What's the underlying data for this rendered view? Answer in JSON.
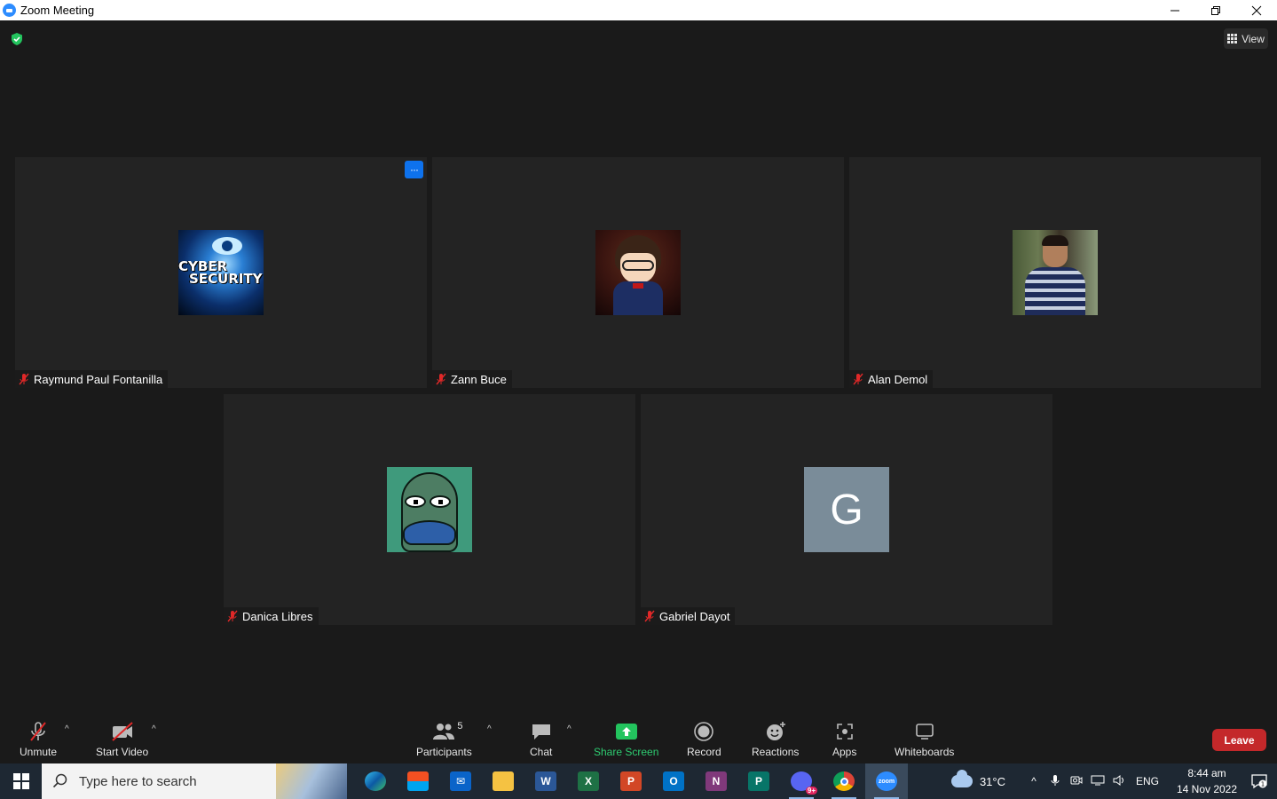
{
  "window": {
    "title": "Zoom Meeting"
  },
  "top": {
    "view_label": "View"
  },
  "participants": [
    {
      "name": "Raymund Paul Fontanilla",
      "avatar": "cyber-security-image",
      "avatar_text_1": "CYBER",
      "avatar_text_2": "SECURITY"
    },
    {
      "name": "Zann Buce",
      "avatar": "anime-character-image"
    },
    {
      "name": "Alan Demol",
      "avatar": "profile-photo"
    },
    {
      "name": "Danica Libres",
      "avatar": "cartoon-fish-image"
    },
    {
      "name": "Gabriel Dayot",
      "avatar": "letter-avatar",
      "initial": "G"
    }
  ],
  "toolbar": {
    "unmute": "Unmute",
    "start_video": "Start Video",
    "participants": "Participants",
    "participants_count": "5",
    "chat": "Chat",
    "share_screen": "Share Screen",
    "record": "Record",
    "reactions": "Reactions",
    "apps": "Apps",
    "whiteboards": "Whiteboards",
    "leave": "Leave"
  },
  "taskbar": {
    "search_placeholder": "Type here to search",
    "temperature": "31°C",
    "language": "ENG",
    "time": "8:44 am",
    "date": "14 Nov 2022",
    "notification_count": "1",
    "discord_badge": "9+"
  },
  "colors": {
    "accent": "#0e72ed",
    "leave": "#c4282a",
    "share": "#2ecc71",
    "muted": "#e02828"
  }
}
